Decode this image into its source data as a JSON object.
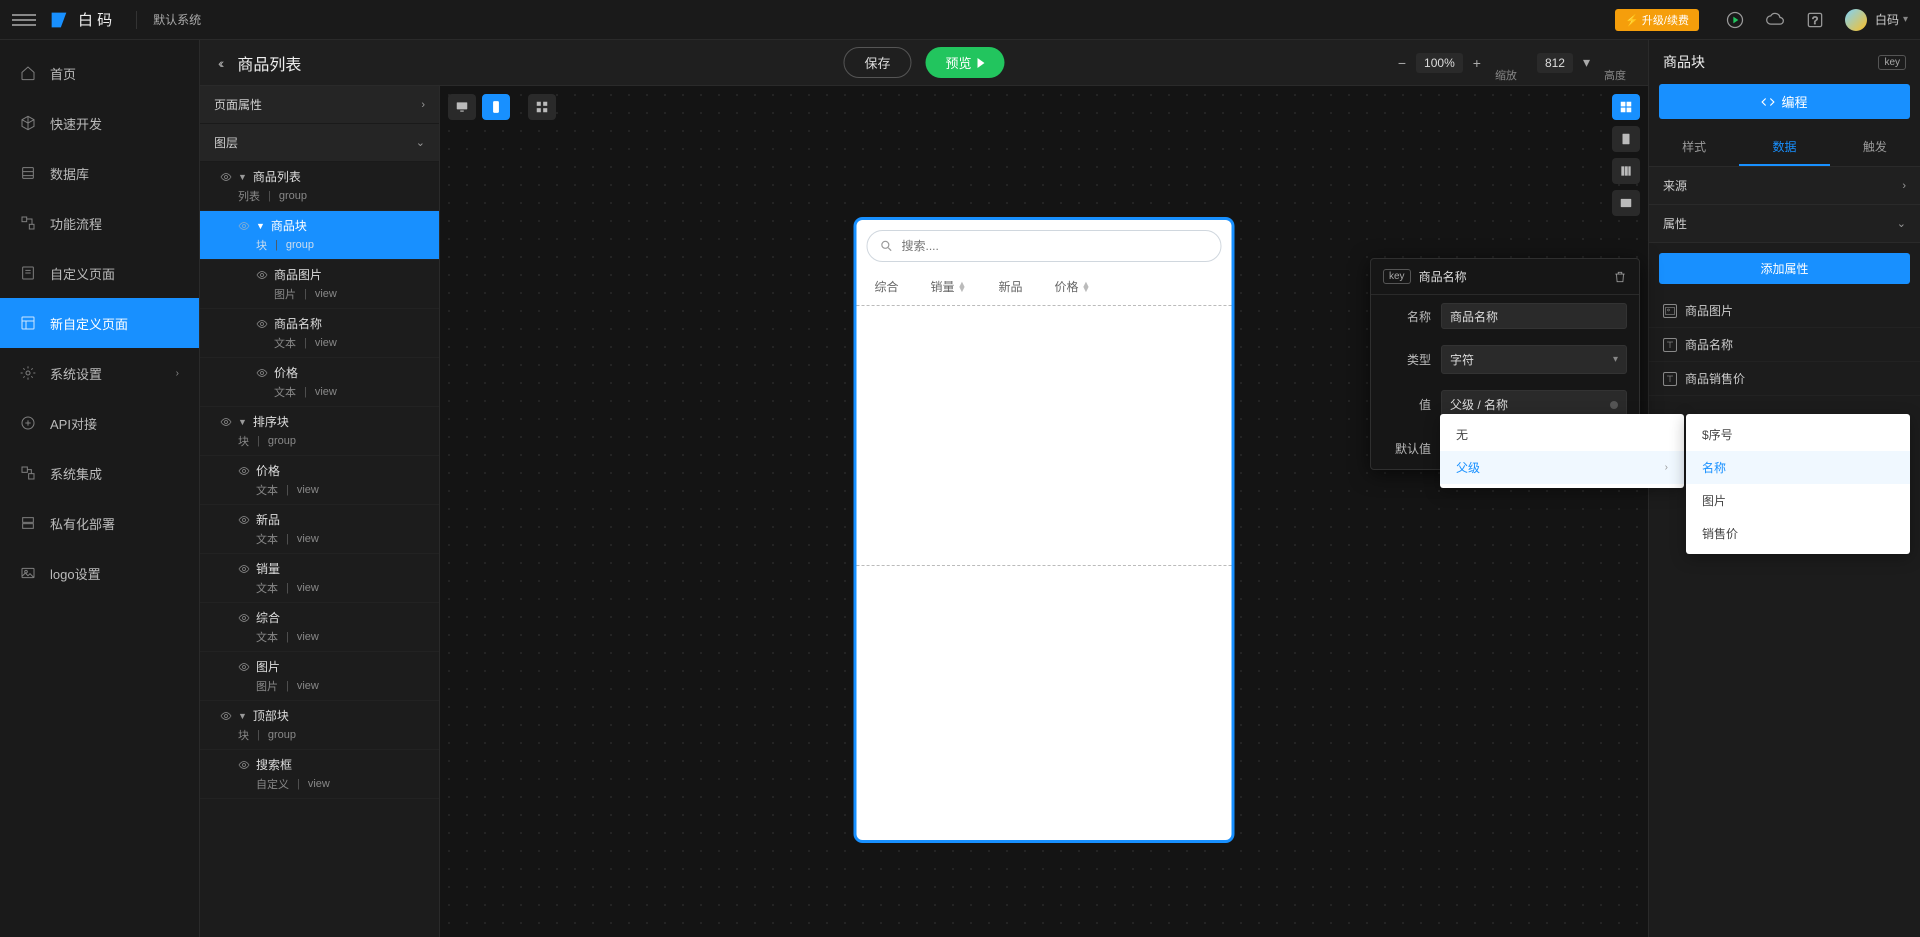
{
  "topbar": {
    "brand": "白 码",
    "system": "默认系统",
    "upgrade": "⚡ 升级/续费",
    "user": "白码"
  },
  "leftnav": [
    {
      "label": "首页",
      "active": false,
      "chev": false
    },
    {
      "label": "快速开发",
      "active": false,
      "chev": false
    },
    {
      "label": "数据库",
      "active": false,
      "chev": false
    },
    {
      "label": "功能流程",
      "active": false,
      "chev": false
    },
    {
      "label": "自定义页面",
      "active": false,
      "chev": false
    },
    {
      "label": "新自定义页面",
      "active": true,
      "chev": false
    },
    {
      "label": "系统设置",
      "active": false,
      "chev": true
    },
    {
      "label": "API对接",
      "active": false,
      "chev": false
    },
    {
      "label": "系统集成",
      "active": false,
      "chev": false
    },
    {
      "label": "私有化部署",
      "active": false,
      "chev": false
    },
    {
      "label": "logo设置",
      "active": false,
      "chev": false
    }
  ],
  "toolbar2": {
    "back": "‹‹",
    "title": "商品列表",
    "save": "保存",
    "preview": "预览",
    "zoom": "100%",
    "zoom_label": "缩放",
    "height": "812",
    "height_label": "高度"
  },
  "layerpanel": {
    "sec_page_attr": "页面属性",
    "sec_layers": "图层",
    "nodes": [
      {
        "name": "商品列表",
        "type": "列表",
        "sub": "group",
        "ind": 1,
        "exp": true,
        "sel": false
      },
      {
        "name": "商品块",
        "type": "块",
        "sub": "group",
        "ind": 2,
        "exp": true,
        "sel": true
      },
      {
        "name": "商品图片",
        "type": "图片",
        "sub": "view",
        "ind": 3,
        "exp": false,
        "sel": false
      },
      {
        "name": "商品名称",
        "type": "文本",
        "sub": "view",
        "ind": 3,
        "exp": false,
        "sel": false
      },
      {
        "name": "价格",
        "type": "文本",
        "sub": "view",
        "ind": 3,
        "exp": false,
        "sel": false
      },
      {
        "name": "排序块",
        "type": "块",
        "sub": "group",
        "ind": 1,
        "exp": true,
        "sel": false
      },
      {
        "name": "价格",
        "type": "文本",
        "sub": "view",
        "ind": 2,
        "exp": false,
        "sel": false
      },
      {
        "name": "新品",
        "type": "文本",
        "sub": "view",
        "ind": 2,
        "exp": false,
        "sel": false
      },
      {
        "name": "销量",
        "type": "文本",
        "sub": "view",
        "ind": 2,
        "exp": false,
        "sel": false
      },
      {
        "name": "综合",
        "type": "文本",
        "sub": "view",
        "ind": 2,
        "exp": false,
        "sel": false
      },
      {
        "name": "图片",
        "type": "图片",
        "sub": "view",
        "ind": 2,
        "exp": false,
        "sel": false
      },
      {
        "name": "顶部块",
        "type": "块",
        "sub": "group",
        "ind": 1,
        "exp": true,
        "sel": false
      },
      {
        "name": "搜索框",
        "type": "自定义",
        "sub": "view",
        "ind": 2,
        "exp": false,
        "sel": false
      }
    ]
  },
  "phone": {
    "search_placeholder": "搜索....",
    "tabs": [
      "综合",
      "销量",
      "新品",
      "价格"
    ]
  },
  "inspector": {
    "title": "商品块",
    "key_tag": "key",
    "program_btn": "编程",
    "tabs": [
      "样式",
      "数据",
      "触发"
    ],
    "active_tab": 1,
    "sec_source": "来源",
    "sec_attr": "属性",
    "add_attr": "添加属性",
    "props": [
      "商品图片",
      "商品名称",
      "商品销售价"
    ]
  },
  "floatdlg": {
    "key_tag": "key",
    "title": "商品名称",
    "rows": {
      "name_label": "名称",
      "name_value": "商品名称",
      "type_label": "类型",
      "type_value": "字符",
      "value_label": "值",
      "value_value": "父级 / 名称",
      "default_label": "默认值",
      "default_value": ""
    }
  },
  "dropdown1": [
    {
      "label": "无",
      "hl": false,
      "chev": false
    },
    {
      "label": "父级",
      "hl": true,
      "chev": true
    }
  ],
  "dropdown2": [
    {
      "label": "$序号",
      "hl": false
    },
    {
      "label": "名称",
      "hl": true
    },
    {
      "label": "图片",
      "hl": false
    },
    {
      "label": "销售价",
      "hl": false
    }
  ]
}
